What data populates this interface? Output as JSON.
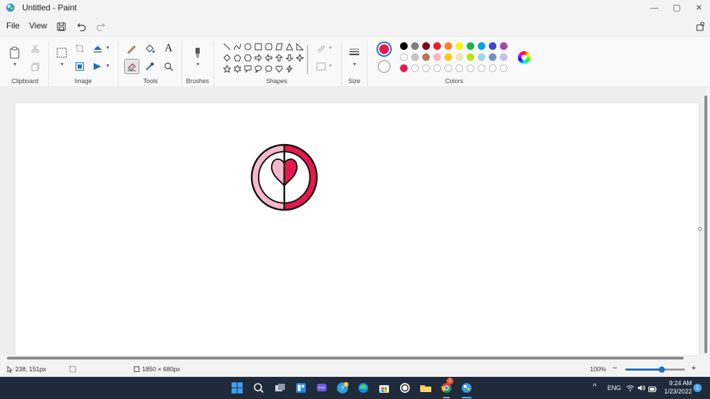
{
  "window": {
    "title": "Untitled - Paint",
    "minimize_glyph": "—",
    "maximize_glyph": "▢",
    "close_glyph": "✕"
  },
  "menu": {
    "file": "File",
    "view": "View"
  },
  "ribbon": {
    "groups": {
      "clipboard": "Clipboard",
      "image": "Image",
      "tools": "Tools",
      "brushes": "Brushes",
      "shapes": "Shapes",
      "size": "Size",
      "colors": "Colors"
    },
    "text_tool_glyph": "A"
  },
  "colors": {
    "primary": "#e8174e",
    "secondary": "#ffffff",
    "row1": [
      "#000000",
      "#7f7f7f",
      "#880015",
      "#ed1c24",
      "#ff7f27",
      "#fff200",
      "#22b14c",
      "#00a2e8",
      "#3f48cc",
      "#a349a4"
    ],
    "row2": [
      "#ffffff",
      "#c3c3c3",
      "#b97a57",
      "#ffaec9",
      "#ffc90e",
      "#efe4b0",
      "#b5e61d",
      "#99d9ea",
      "#7092be",
      "#c8bfe7"
    ],
    "row3": [
      "#e8174e",
      "",
      "",
      "",
      "",
      "",
      "",
      "",
      "",
      ""
    ],
    "heart_light": "#f7b6cb",
    "heart_dark": "#e8174e"
  },
  "status": {
    "cursor_position": "238, 151px",
    "canvas_size": "1850 × 680px",
    "zoom": "100%",
    "zoom_slider_fraction": 0.6
  },
  "taskbar": {
    "language": "ENG",
    "time": "9:24 AM",
    "date": "1/23/2022",
    "notification_count": "1",
    "chrome_badge": "1"
  }
}
